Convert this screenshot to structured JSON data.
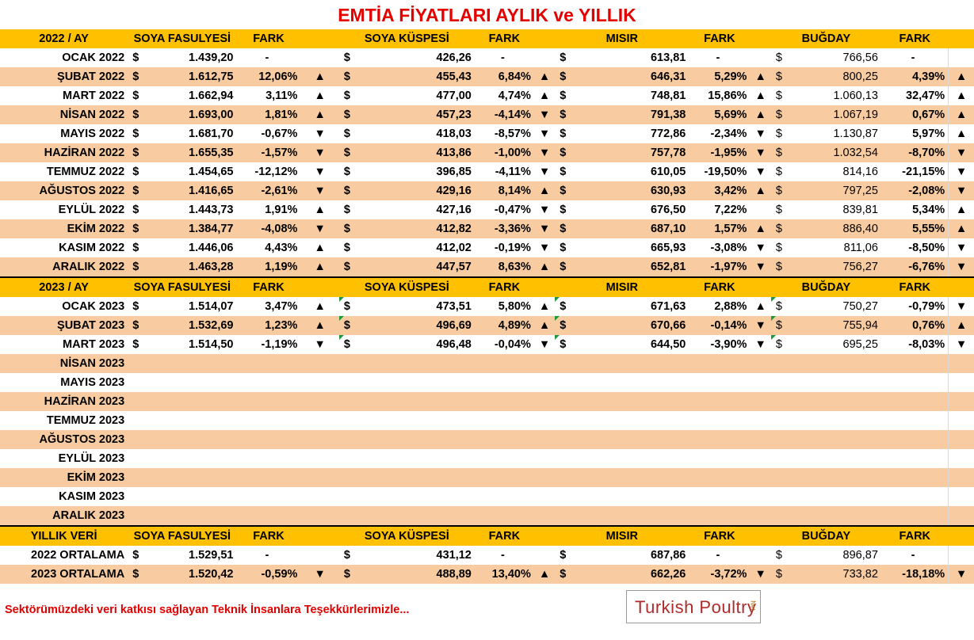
{
  "title": "EMTİA FİYATLARI AYLIK ve YILLIK",
  "colors": {
    "header_bg": "#ffc000",
    "row_alt": "#f8cca0",
    "up": "#00a650",
    "down": "#c00000",
    "title": "#e50000"
  },
  "headers": {
    "h2022": [
      "2022 / AY",
      "SOYA FASULYESİ",
      "FARK",
      "SOYA KÜSPESİ",
      "FARK",
      "MISIR",
      "FARK",
      "BUĞDAY",
      "FARK"
    ],
    "h2023": [
      "2023 / AY",
      "SOYA FASULYESİ",
      "FARK",
      "SOYA KÜSPESİ",
      "FARK",
      "MISIR",
      "FARK",
      "BUĞDAY",
      "FARK"
    ],
    "hyear": [
      "YILLIK VERİ",
      "SOYA FASULYESİ",
      "FARK",
      "SOYA KÜSPESİ",
      "FARK",
      "MISIR",
      "FARK",
      "BUĞDAY",
      "FARK"
    ]
  },
  "currency": "$",
  "rows2022": [
    {
      "m": "OCAK 2022",
      "v": [
        "1.439,20",
        "426,26",
        "613,81",
        "766,56"
      ],
      "p": [
        "-",
        "-",
        "-",
        "-"
      ],
      "a": [
        "",
        "",
        "",
        ""
      ]
    },
    {
      "m": "ŞUBAT 2022",
      "v": [
        "1.612,75",
        "455,43",
        "646,31",
        "800,25"
      ],
      "p": [
        "12,06%",
        "6,84%",
        "5,29%",
        "4,39%"
      ],
      "a": [
        "up",
        "up",
        "up",
        "up"
      ]
    },
    {
      "m": "MART 2022",
      "v": [
        "1.662,94",
        "477,00",
        "748,81",
        "1.060,13"
      ],
      "p": [
        "3,11%",
        "4,74%",
        "15,86%",
        "32,47%"
      ],
      "a": [
        "up",
        "up",
        "up",
        "up"
      ]
    },
    {
      "m": "NİSAN 2022",
      "v": [
        "1.693,00",
        "457,23",
        "791,38",
        "1.067,19"
      ],
      "p": [
        "1,81%",
        "-4,14%",
        "5,69%",
        "0,67%"
      ],
      "a": [
        "up",
        "down",
        "up",
        "up"
      ]
    },
    {
      "m": "MAYIS 2022",
      "v": [
        "1.681,70",
        "418,03",
        "772,86",
        "1.130,87"
      ],
      "p": [
        "-0,67%",
        "-8,57%",
        "-2,34%",
        "5,97%"
      ],
      "a": [
        "down",
        "down",
        "down",
        "up"
      ]
    },
    {
      "m": "HAZİRAN 2022",
      "v": [
        "1.655,35",
        "413,86",
        "757,78",
        "1.032,54"
      ],
      "p": [
        "-1,57%",
        "-1,00%",
        "-1,95%",
        "-8,70%"
      ],
      "a": [
        "down",
        "down",
        "down",
        "down"
      ]
    },
    {
      "m": "TEMMUZ 2022",
      "v": [
        "1.454,65",
        "396,85",
        "610,05",
        "814,16"
      ],
      "p": [
        "-12,12%",
        "-4,11%",
        "-19,50%",
        "-21,15%"
      ],
      "a": [
        "down",
        "down",
        "down",
        "down"
      ]
    },
    {
      "m": "AĞUSTOS 2022",
      "v": [
        "1.416,65",
        "429,16",
        "630,93",
        "797,25"
      ],
      "p": [
        "-2,61%",
        "8,14%",
        "3,42%",
        "-2,08%"
      ],
      "a": [
        "down",
        "up",
        "up",
        "down"
      ]
    },
    {
      "m": "EYLÜL 2022",
      "v": [
        "1.443,73",
        "427,16",
        "676,50",
        "839,81"
      ],
      "p": [
        "1,91%",
        "-0,47%",
        "7,22%",
        "5,34%"
      ],
      "a": [
        "up",
        "down",
        "",
        "up"
      ]
    },
    {
      "m": "EKİM 2022",
      "v": [
        "1.384,77",
        "412,82",
        "687,10",
        "886,40"
      ],
      "p": [
        "-4,08%",
        "-3,36%",
        "1,57%",
        "5,55%"
      ],
      "a": [
        "down",
        "down",
        "up",
        "up"
      ]
    },
    {
      "m": "KASIM 2022",
      "v": [
        "1.446,06",
        "412,02",
        "665,93",
        "811,06"
      ],
      "p": [
        "4,43%",
        "-0,19%",
        "-3,08%",
        "-8,50%"
      ],
      "a": [
        "up",
        "down",
        "down",
        "down"
      ]
    },
    {
      "m": "ARALIK 2022",
      "v": [
        "1.463,28",
        "447,57",
        "652,81",
        "756,27"
      ],
      "p": [
        "1,19%",
        "8,63%",
        "-1,97%",
        "-6,76%"
      ],
      "a": [
        "up",
        "up",
        "down",
        "down"
      ]
    }
  ],
  "rows2023": [
    {
      "m": "OCAK 2023",
      "v": [
        "1.514,07",
        "473,51",
        "671,63",
        "750,27"
      ],
      "p": [
        "3,47%",
        "5,80%",
        "2,88%",
        "-0,79%"
      ],
      "a": [
        "up",
        "up",
        "up",
        "down"
      ]
    },
    {
      "m": "ŞUBAT 2023",
      "v": [
        "1.532,69",
        "496,69",
        "670,66",
        "755,94"
      ],
      "p": [
        "1,23%",
        "4,89%",
        "-0,14%",
        "0,76%"
      ],
      "a": [
        "up",
        "up",
        "down",
        "up"
      ]
    },
    {
      "m": "MART 2023",
      "v": [
        "1.514,50",
        "496,48",
        "644,50",
        "695,25"
      ],
      "p": [
        "-1,19%",
        "-0,04%",
        "-3,90%",
        "-8,03%"
      ],
      "a": [
        "down",
        "down",
        "down",
        "down"
      ]
    },
    {
      "m": "NİSAN 2023"
    },
    {
      "m": "MAYIS 2023"
    },
    {
      "m": "HAZİRAN 2023"
    },
    {
      "m": "TEMMUZ 2023"
    },
    {
      "m": "AĞUSTOS 2023"
    },
    {
      "m": "EYLÜL 2023"
    },
    {
      "m": "EKİM 2023"
    },
    {
      "m": "KASIM 2023"
    },
    {
      "m": "ARALIK 2023"
    }
  ],
  "rowsYear": [
    {
      "m": "2022 ORTALAMA",
      "v": [
        "1.529,51",
        "431,12",
        "687,86",
        "896,87"
      ],
      "p": [
        "-",
        "-",
        "-",
        "-"
      ],
      "a": [
        "",
        "",
        "",
        ""
      ]
    },
    {
      "m": "2023 ORTALAMA",
      "v": [
        "1.520,42",
        "488,89",
        "662,26",
        "733,82"
      ],
      "p": [
        "-0,59%",
        "13,40%",
        "-3,72%",
        "-18,18%"
      ],
      "a": [
        "down",
        "up",
        "down",
        "down"
      ]
    }
  ],
  "footer": "Sektörümüzdeki veri katkısı sağlayan Teknik İnsanlara Teşekkürlerimizle...",
  "logo": {
    "text": "Turkish Poultry",
    "suffix": "Net"
  }
}
